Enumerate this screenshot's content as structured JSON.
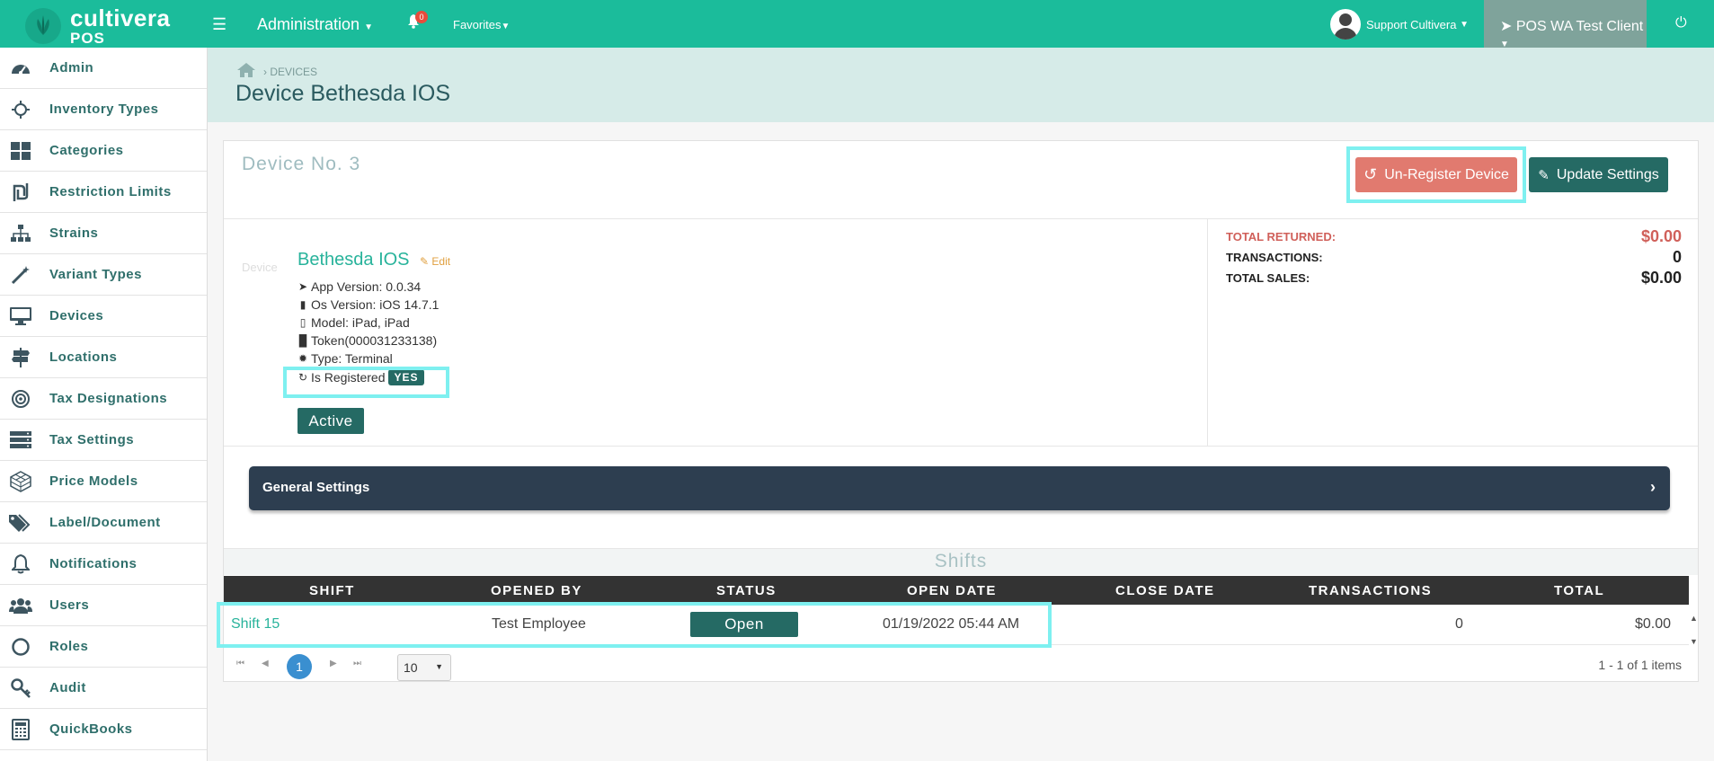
{
  "topbar": {
    "logo_line1": "cultivera",
    "logo_line2": "POS",
    "menu_admin": "Administration",
    "notification_count": "0",
    "menu_favorites": "Favorites",
    "user_name": "Support Cultivera",
    "client_name": "POS WA Test Client"
  },
  "sidebar": {
    "items": [
      {
        "label": "Admin",
        "icon": "dashboard-icon"
      },
      {
        "label": "Inventory Types",
        "icon": "crosshair-icon"
      },
      {
        "label": "Categories",
        "icon": "grid-icon"
      },
      {
        "label": "Restriction Limits",
        "icon": "shekel-icon"
      },
      {
        "label": "Strains",
        "icon": "sitemap-icon"
      },
      {
        "label": "Variant Types",
        "icon": "magic-wand-icon"
      },
      {
        "label": "Devices",
        "icon": "desktop-icon"
      },
      {
        "label": "Locations",
        "icon": "signpost-icon"
      },
      {
        "label": "Tax Designations",
        "icon": "target-icon"
      },
      {
        "label": "Tax Settings",
        "icon": "server-icon"
      },
      {
        "label": "Price Models",
        "icon": "cube-icon"
      },
      {
        "label": "Label/Document",
        "icon": "tags-icon"
      },
      {
        "label": "Notifications",
        "icon": "bell-icon"
      },
      {
        "label": "Users",
        "icon": "users-icon"
      },
      {
        "label": "Roles",
        "icon": "circle-icon"
      },
      {
        "label": "Audit",
        "icon": "key-icon"
      },
      {
        "label": "QuickBooks",
        "icon": "calculator-icon"
      }
    ]
  },
  "breadcrumb": {
    "section": "DEVICES"
  },
  "page": {
    "title": "Device Bethesda IOS"
  },
  "device": {
    "number_label": "Device No. 3",
    "unregister_label": "Un-Register Device",
    "update_label": "Update Settings",
    "side_label": "Device",
    "name": "Bethesda IOS",
    "edit_label": "Edit",
    "app_version": "App Version: 0.0.34",
    "os_version": "Os Version: iOS 14.7.1",
    "model": "Model: iPad, iPad",
    "token": "Token(000031233138)",
    "type": "Type: Terminal",
    "registered_label": "Is Registered",
    "registered_value": "YES",
    "status": "Active"
  },
  "stats": {
    "total_returned_label": "TOTAL RETURNED:",
    "total_returned": "$0.00",
    "transactions_label": "TRANSACTIONS:",
    "transactions": "0",
    "total_sales_label": "TOTAL SALES:",
    "total_sales": "$0.00"
  },
  "general_settings": {
    "label": "General Settings"
  },
  "shifts": {
    "title": "Shifts",
    "columns": [
      "SHIFT",
      "OPENED BY",
      "STATUS",
      "OPEN DATE",
      "CLOSE DATE",
      "TRANSACTIONS",
      "TOTAL"
    ],
    "rows": [
      {
        "shift": "Shift 15",
        "opened_by": "Test Employee",
        "status": "Open",
        "open_date": "01/19/2022 05:44 AM",
        "close_date": "",
        "transactions": "0",
        "total": "$0.00"
      }
    ],
    "pager": {
      "current_page": "1",
      "page_size": "10",
      "info": "1 - 1 of 1 items"
    }
  },
  "colors": {
    "brand": "#1bbc9b",
    "dark_teal": "#256a64",
    "danger": "#e17a6f",
    "highlight": "#7ef0f0"
  }
}
